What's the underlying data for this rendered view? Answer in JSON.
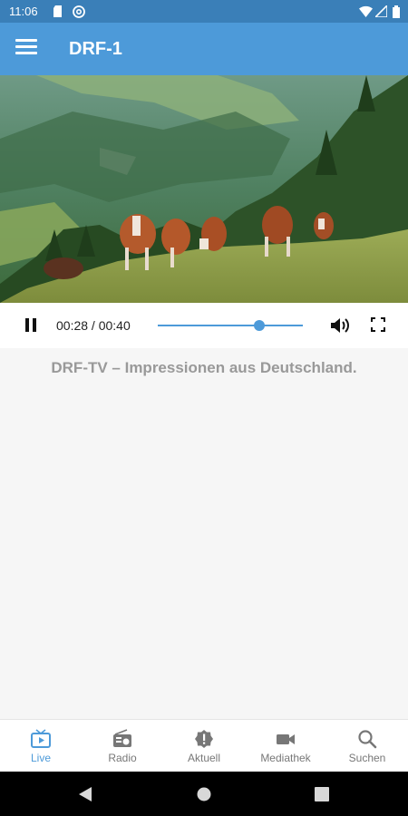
{
  "status_bar": {
    "time": "11:06"
  },
  "app_bar": {
    "title": "DRF-1"
  },
  "player": {
    "current_time": "00:28",
    "duration": "00:40",
    "time_display": "00:28 / 00:40",
    "progress_fraction": 0.7
  },
  "caption": "DRF-TV – Impressionen aus Deutschland.",
  "bottom_nav": {
    "items": [
      {
        "label": "Live",
        "icon": "tv-play-icon",
        "active": true
      },
      {
        "label": "Radio",
        "icon": "radio-icon",
        "active": false
      },
      {
        "label": "Aktuell",
        "icon": "alert-badge-icon",
        "active": false
      },
      {
        "label": "Mediathek",
        "icon": "video-camera-icon",
        "active": false
      },
      {
        "label": "Suchen",
        "icon": "search-icon",
        "active": false
      }
    ]
  },
  "colors": {
    "app_bar": "#4d9ad9",
    "status_bar": "#3a7fb8",
    "accent": "#4d9ad9",
    "caption_text": "#999999"
  }
}
